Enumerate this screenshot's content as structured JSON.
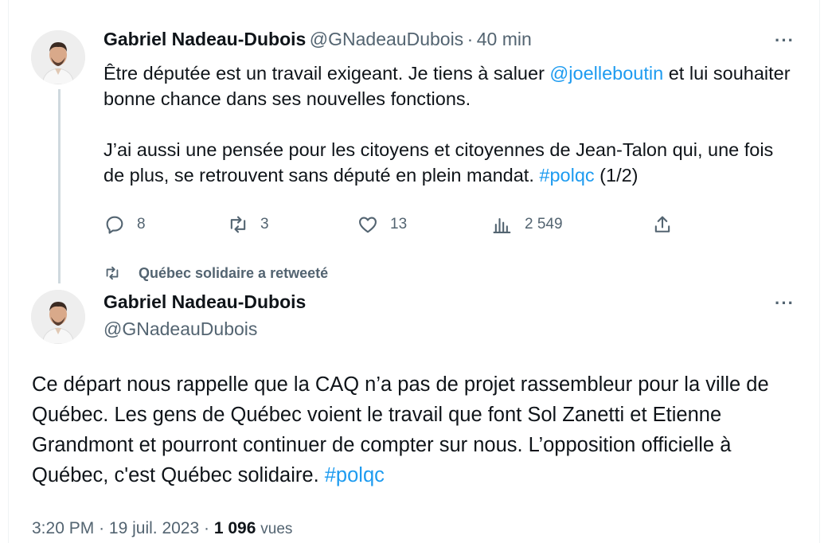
{
  "tweet1": {
    "author_name": "Gabriel Nadeau-Dubois",
    "handle": "@GNadeauDubois",
    "separator": "·",
    "time": "40 min",
    "more_label": "···",
    "p1_before": "Être députée est un travail exigeant. Je tiens à saluer ",
    "p1_mention": "@joelleboutin",
    "p1_after": " et lui souhaiter bonne chance dans ses nouvelles fonctions.",
    "p2_before": "J’ai aussi une pensée pour les citoyens et citoyennes de Jean-Talon qui, une fois de plus, se retrouvent sans député en plein mandat. ",
    "p2_hashtag": "#polqc",
    "p2_after": " (1/2)",
    "actions": {
      "replies": "8",
      "retweets": "3",
      "likes": "13",
      "views": "2 549"
    }
  },
  "retweet_context": {
    "label": "Québec solidaire a retweeté"
  },
  "tweet2": {
    "author_name": "Gabriel Nadeau-Dubois",
    "handle": "@GNadeauDubois",
    "more_label": "···",
    "text_before": "Ce départ nous rappelle que la CAQ n’a pas de projet rassembleur pour la ville de Québec. Les gens de Québec voient le travail que font Sol Zanetti et Etienne Grandmont et pourront continuer de compter sur nous. L’opposition officielle à Québec, c'est Québec solidaire. ",
    "hashtag": "#polqc",
    "time": "3:20 PM",
    "separator": "·",
    "date": "19 juil. 2023",
    "separator2": "·",
    "views_count": "1 096",
    "views_label": "vues"
  },
  "colors": {
    "link": "#1d9bf0",
    "secondary_text": "#536471",
    "thread_line": "#cfd9de"
  }
}
